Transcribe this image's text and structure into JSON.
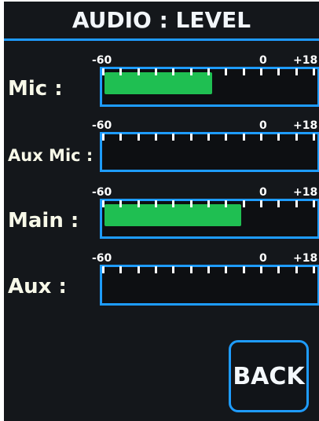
{
  "header": {
    "title": "AUDIO : LEVEL"
  },
  "scale_labels": {
    "min": "-60",
    "zero": "0",
    "max": "+18"
  },
  "channels": [
    {
      "label": "Mic :",
      "level_fraction": 0.51
    },
    {
      "label": "Aux Mic :",
      "level_fraction": 0.0
    },
    {
      "label": "Main :",
      "level_fraction": 0.65
    },
    {
      "label": "Aux :",
      "level_fraction": 0.0
    }
  ],
  "buttons": {
    "back_label": "BACK"
  },
  "colors": {
    "accent": "#1e9cff",
    "meter_fill": "#1fbf52",
    "background": "#14171b"
  }
}
